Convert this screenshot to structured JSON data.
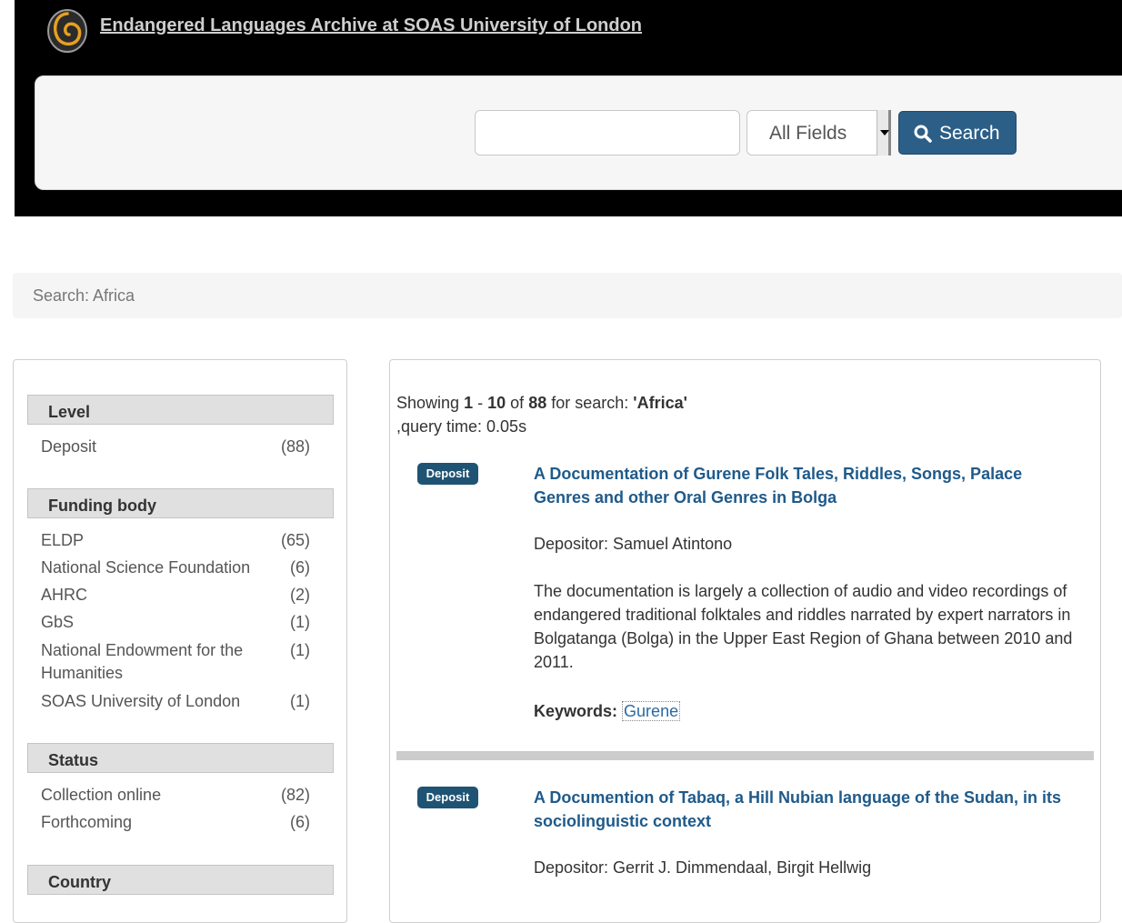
{
  "header": {
    "site_title": "Endangered Languages Archive at SOAS University of London",
    "logo_icon": "elar-spiral-logo"
  },
  "search": {
    "query_value": "",
    "field_selected": "All Fields",
    "button_label": "Search",
    "button_color": "#2c5f87"
  },
  "breadcrumb": {
    "text": "Search: Africa"
  },
  "facets": {
    "level": {
      "heading": "Level",
      "items": [
        {
          "label": "Deposit",
          "count": "(88)"
        }
      ]
    },
    "funding_body": {
      "heading": "Funding body",
      "items": [
        {
          "label": "ELDP",
          "count": "(65)"
        },
        {
          "label": "National Science Foundation",
          "count": "(6)"
        },
        {
          "label": "AHRC",
          "count": "(2)"
        },
        {
          "label": "GbS",
          "count": "(1)"
        },
        {
          "label": "National Endowment for the Humanities",
          "count": "(1)"
        },
        {
          "label": "SOAS University of London",
          "count": "(1)"
        }
      ]
    },
    "status": {
      "heading": "Status",
      "items": [
        {
          "label": "Collection online",
          "count": "(82)"
        },
        {
          "label": "Forthcoming",
          "count": "(6)"
        }
      ]
    },
    "country": {
      "heading": "Country"
    }
  },
  "summary": {
    "showing": "Showing",
    "from": "1",
    "dash": "-",
    "to": "10",
    "of": "of",
    "total": "88",
    "for_search": "for search:",
    "query": "'Africa'",
    "query_time": ",query time: 0.05s"
  },
  "results": [
    {
      "badge": "Deposit",
      "title": "A Documentation of Gurene Folk Tales, Riddles, Songs, Palace Genres and other Oral Genres in Bolga",
      "depositor": "Depositor: Samuel Atintono",
      "description": "The documentation is largely a collection of audio and video recordings of endangered traditional folktales and riddles narrated by expert narrators in Bolgatanga (Bolga) in the Upper East Region of Ghana between 2010 and 2011.",
      "keywords_label": "Keywords:",
      "keyword": "Gurene"
    },
    {
      "badge": "Deposit",
      "title": "A Documention of Tabaq, a Hill Nubian language of the Sudan, in its sociolinguistic context",
      "depositor": "Depositor: Gerrit J. Dimmendaal, Birgit Hellwig"
    }
  ]
}
